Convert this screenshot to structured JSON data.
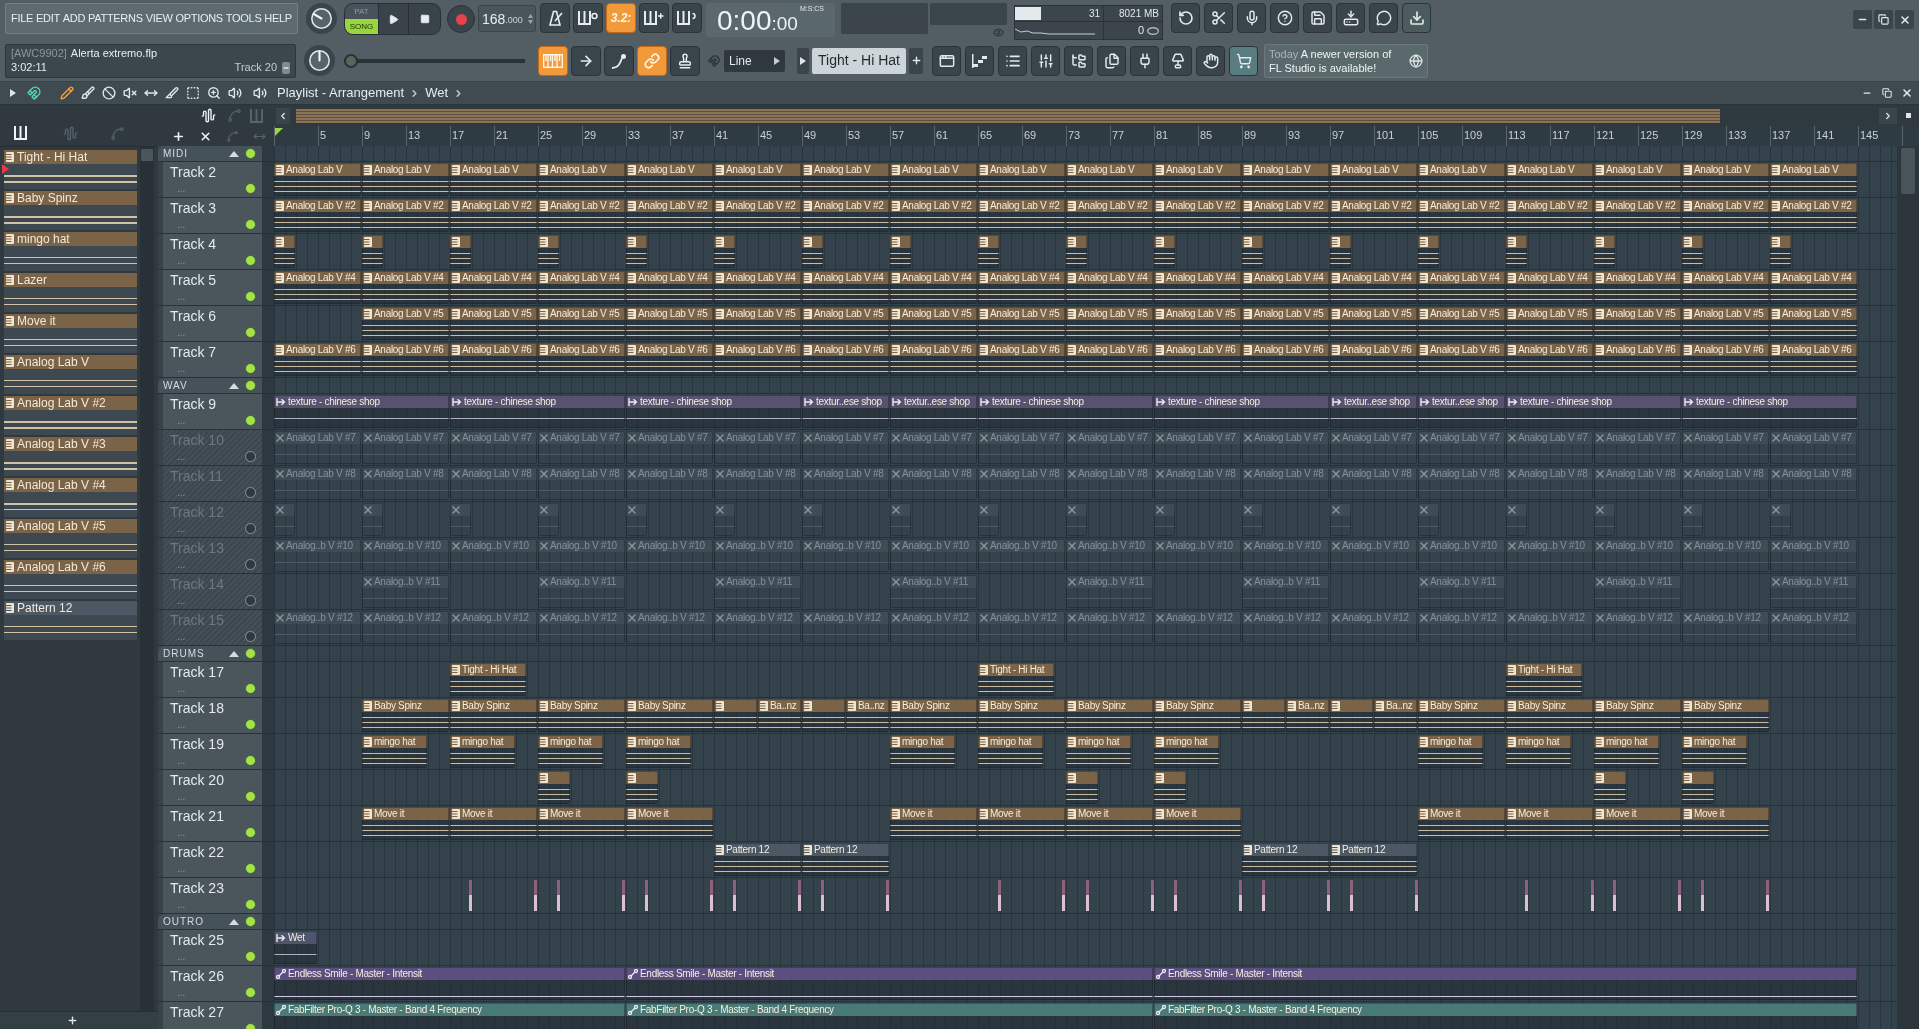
{
  "menu": [
    "FILE",
    "EDIT",
    "ADD",
    "PATTERNS",
    "VIEW",
    "OPTIONS",
    "TOOLS",
    "HELP"
  ],
  "mode": [
    {
      "label": "PAT",
      "selected": false
    },
    {
      "label": "SONG",
      "selected": true
    }
  ],
  "tempo": {
    "whole": "168",
    "fraction": ".000"
  },
  "record_toggles": [
    {
      "kind": "metronome",
      "on": false
    },
    {
      "kind": "wait",
      "on": false
    },
    {
      "kind": "countdown",
      "label": "3.2:",
      "on": true
    },
    {
      "kind": "overdub",
      "on": false
    },
    {
      "kind": "loop",
      "on": false
    }
  ],
  "time": {
    "main": "0:00",
    "fraction": ":00",
    "format": "M:S:CS"
  },
  "monitor": {
    "cpu": "31",
    "cpu_meter": {
      "level": 0.3
    },
    "memory": "8021 MB",
    "polyphony": "0"
  },
  "project": {
    "tag": "[AWC9902]",
    "file": "Alerta extremo.flp",
    "length": "3:02:11",
    "hint": "Track 20"
  },
  "song_position": {
    "level": 0
  },
  "edit_toggles": [
    {
      "kind": "keyboard",
      "on": true
    },
    {
      "kind": "arrow",
      "on": false
    },
    {
      "kind": "slide",
      "on": false
    },
    {
      "kind": "link",
      "on": true
    },
    {
      "kind": "stamp",
      "on": false
    }
  ],
  "snap": "Line",
  "pattern_selector": "Tight - Hi Hat",
  "news": {
    "date": "Today",
    "text": "A newer version of FL Studio is available!"
  },
  "playlist": {
    "title": "Playlist - Arrangement",
    "breadcrumb": "Wet",
    "tools": [
      {
        "kind": "pencil",
        "selected": true
      },
      {
        "kind": "paint",
        "selected": false
      },
      {
        "kind": "delete",
        "selected": false
      },
      {
        "kind": "mute",
        "selected": false
      },
      {
        "kind": "slip",
        "selected": false
      },
      {
        "kind": "slice",
        "selected": false
      },
      {
        "kind": "select",
        "selected": false
      },
      {
        "kind": "zoom",
        "selected": false
      },
      {
        "kind": "playback",
        "selected": false
      }
    ],
    "browser_tabs": [
      {
        "kind": "piano",
        "selected": true
      },
      {
        "kind": "wave",
        "selected": false
      },
      {
        "kind": "automation",
        "selected": false
      }
    ],
    "patterns": [
      {
        "name": "Tight - Hi Hat",
        "color": "#7b6347",
        "selected": true
      },
      {
        "name": "Baby Spinz",
        "color": "#7b6347",
        "selected": false
      },
      {
        "name": "mingo hat",
        "color": "#7b6347",
        "selected": false
      },
      {
        "name": "Lazer",
        "color": "#7b6347",
        "selected": false
      },
      {
        "name": "Move it",
        "color": "#7b6347",
        "selected": false
      },
      {
        "name": "Analog Lab V",
        "color": "#7b6347",
        "selected": false
      },
      {
        "name": "Analog Lab V #2",
        "color": "#7b6347",
        "selected": false
      },
      {
        "name": "Analog Lab V #3",
        "color": "#7b6347",
        "selected": false
      },
      {
        "name": "Analog Lab V #4",
        "color": "#7b6347",
        "selected": false
      },
      {
        "name": "Analog Lab V #5",
        "color": "#7b6347",
        "selected": false
      },
      {
        "name": "Analog Lab V #6",
        "color": "#7b6347",
        "selected": false
      },
      {
        "name": "Pattern 12",
        "color": "#4c5863",
        "selected": false
      }
    ],
    "track_filters": [
      {
        "kind": "wave",
        "on": true
      },
      {
        "kind": "automation",
        "on": false
      },
      {
        "kind": "piano",
        "on": false
      }
    ],
    "track_tools": [
      {
        "kind": "add",
        "disabled": false
      },
      {
        "kind": "remove",
        "disabled": false
      },
      {
        "kind": "curve",
        "disabled": true
      },
      {
        "kind": "swap",
        "disabled": true
      }
    ],
    "ruler": [
      "5",
      "9",
      "13",
      "17",
      "21",
      "25",
      "29",
      "33",
      "37",
      "41",
      "45",
      "49",
      "53",
      "57",
      "61",
      "65",
      "69",
      "73",
      "77",
      "81",
      "85",
      "89",
      "93",
      "97",
      "101",
      "105",
      "109",
      "113",
      "117",
      "121",
      "125",
      "129",
      "133",
      "137",
      "141",
      "145"
    ],
    "groups": [
      {
        "name": "MIDI",
        "enabled": true,
        "expanded": true,
        "tracks": [
          {
            "name": "Track 2",
            "subtitle": "...",
            "enabled": true,
            "color": "#7b6347",
            "kind": "pattern",
            "clips": [
              {
                "label": "Analog Lab V",
                "selected": false
              },
              {
                "label": "Analog Lab V",
                "selected": false
              },
              {
                "label": "Analog Lab V",
                "selected": false
              },
              {
                "label": "Analog Lab V",
                "selected": false
              },
              {
                "label": "Analog Lab V",
                "selected": false
              },
              {
                "label": "Analog Lab V",
                "selected": false
              },
              {
                "label": "Analog Lab V",
                "selected": false
              },
              {
                "label": "Analog Lab V",
                "selected": false
              },
              {
                "label": "Analog Lab V",
                "selected": false
              },
              {
                "label": "Analog Lab V",
                "selected": false
              },
              {
                "label": "Analog Lab V",
                "selected": false
              },
              {
                "label": "Analog Lab V",
                "selected": false
              },
              {
                "label": "Analog Lab V",
                "selected": false
              },
              {
                "label": "Analog Lab V",
                "selected": false
              },
              {
                "label": "Analog Lab V",
                "selected": false
              },
              {
                "label": "Analog Lab V",
                "selected": false
              },
              {
                "label": "Analog Lab V",
                "selected": false
              },
              {
                "label": "Analog Lab V",
                "selected": false
              }
            ]
          },
          {
            "name": "Track 3",
            "subtitle": "...",
            "enabled": true,
            "color": "#7b6347",
            "kind": "pattern",
            "clips": [
              {
                "label": "Analog Lab V #2",
                "selected": false
              },
              {
                "label": "Analog Lab V #2",
                "selected": false
              },
              {
                "label": "Analog Lab V #2",
                "selected": false
              },
              {
                "label": "Analog Lab V #2",
                "selected": false
              },
              {
                "label": "Analog Lab V #2",
                "selected": false
              },
              {
                "label": "Analog Lab V #2",
                "selected": false
              },
              {
                "label": "Analog Lab V #2",
                "selected": false
              },
              {
                "label": "Analog Lab V #2",
                "selected": false
              },
              {
                "label": "Analog Lab V #2",
                "selected": false
              },
              {
                "label": "Analog Lab V #2",
                "selected": false
              },
              {
                "label": "Analog Lab V #2",
                "selected": false
              },
              {
                "label": "Analog Lab V #2",
                "selected": false
              },
              {
                "label": "Analog Lab V #2",
                "selected": false
              },
              {
                "label": "Analog Lab V #2",
                "selected": false
              },
              {
                "label": "Analog Lab V #2",
                "selected": false
              },
              {
                "label": "Analog Lab V #2",
                "selected": false
              },
              {
                "label": "Analog Lab V #2",
                "selected": false
              },
              {
                "label": "Analog Lab V #2",
                "selected": false
              }
            ]
          },
          {
            "name": "Track 4",
            "subtitle": "...",
            "enabled": true,
            "color": "#7b6347",
            "kind": "pattern",
            "clips": [
              {
                "selected": false
              },
              {
                "selected": false
              },
              {
                "selected": false
              },
              {
                "selected": false
              },
              {
                "selected": false
              },
              {
                "selected": false
              },
              {
                "selected": false
              },
              {
                "selected": false
              },
              {
                "selected": false
              },
              {
                "selected": false
              },
              {
                "selected": false
              },
              {
                "selected": false
              },
              {
                "selected": false
              },
              {
                "selected": false
              },
              {
                "selected": false
              },
              {
                "selected": false
              },
              {
                "selected": false
              },
              {
                "selected": false
              }
            ]
          },
          {
            "name": "Track 5",
            "subtitle": "...",
            "enabled": true,
            "color": "#7b6347",
            "kind": "pattern",
            "clips": [
              {
                "label": "Analog Lab V #4",
                "selected": false
              },
              {
                "label": "Analog Lab V #4",
                "selected": false
              },
              {
                "label": "Analog Lab V #4",
                "selected": false
              },
              {
                "label": "Analog Lab V #4",
                "selected": false
              },
              {
                "label": "Analog Lab V #4",
                "selected": false
              },
              {
                "label": "Analog Lab V #4",
                "selected": false
              },
              {
                "label": "Analog Lab V #4",
                "selected": false
              },
              {
                "label": "Analog Lab V #4",
                "selected": false
              },
              {
                "label": "Analog Lab V #4",
                "selected": false
              },
              {
                "label": "Analog Lab V #4",
                "selected": false
              },
              {
                "label": "Analog Lab V #4",
                "selected": false
              },
              {
                "label": "Analog Lab V #4",
                "selected": false
              },
              {
                "label": "Analog Lab V #4",
                "selected": false
              },
              {
                "label": "Analog Lab V #4",
                "selected": false
              },
              {
                "label": "Analog Lab V #4",
                "selected": false
              },
              {
                "label": "Analog Lab V #4",
                "selected": false
              },
              {
                "label": "Analog Lab V #4",
                "selected": false
              },
              {
                "label": "Analog Lab V #4",
                "selected": false
              }
            ]
          },
          {
            "name": "Track 6",
            "subtitle": "...",
            "enabled": true,
            "color": "#7b6347",
            "kind": "pattern",
            "clips": [
              {
                "label": "Analog Lab V #5",
                "selected": false
              },
              {
                "label": "Analog Lab V #5",
                "selected": false
              },
              {
                "label": "Analog Lab V #5",
                "selected": false
              },
              {
                "label": "Analog Lab V #5",
                "selected": false
              },
              {
                "label": "Analog Lab V #5",
                "selected": false
              },
              {
                "label": "Analog Lab V #5",
                "selected": false
              },
              {
                "label": "Analog Lab V #5",
                "selected": false
              },
              {
                "label": "Analog Lab V #5",
                "selected": false
              },
              {
                "label": "Analog Lab V #5",
                "selected": false
              },
              {
                "label": "Analog Lab V #5",
                "selected": false
              },
              {
                "label": "Analog Lab V #5",
                "selected": false
              },
              {
                "label": "Analog Lab V #5",
                "selected": false
              },
              {
                "label": "Analog Lab V #5",
                "selected": false
              },
              {
                "label": "Analog Lab V #5",
                "selected": false
              },
              {
                "label": "Analog Lab V #5",
                "selected": false
              },
              {
                "label": "Analog Lab V #5",
                "selected": false
              },
              {
                "label": "Analog Lab V #5",
                "selected": false
              }
            ]
          },
          {
            "name": "Track 7",
            "subtitle": "...",
            "enabled": true,
            "color": "#7b6347",
            "kind": "pattern",
            "clips": [
              {
                "label": "Analog Lab V #6",
                "selected": false
              },
              {
                "label": "Analog Lab V #6",
                "selected": false
              },
              {
                "label": "Analog Lab V #6",
                "selected": false
              },
              {
                "label": "Analog Lab V #6",
                "selected": false
              },
              {
                "label": "Analog Lab V #6",
                "selected": false
              },
              {
                "label": "Analog Lab V #6",
                "selected": false
              },
              {
                "label": "Analog Lab V #6",
                "selected": false
              },
              {
                "label": "Analog Lab V #6",
                "selected": false
              },
              {
                "label": "Analog Lab V #6",
                "selected": false
              },
              {
                "label": "Analog Lab V #6",
                "selected": false
              },
              {
                "label": "Analog Lab V #6",
                "selected": false
              },
              {
                "label": "Analog Lab V #6",
                "selected": false
              },
              {
                "label": "Analog Lab V #6",
                "selected": false
              },
              {
                "label": "Analog Lab V #6",
                "selected": false
              },
              {
                "label": "Analog Lab V #6",
                "selected": false
              },
              {
                "label": "Analog Lab V #6",
                "selected": false
              },
              {
                "label": "Analog Lab V #6",
                "selected": false
              },
              {
                "label": "Analog Lab V #6",
                "selected": false
              }
            ]
          }
        ]
      },
      {
        "name": "WAV",
        "enabled": true,
        "expanded": true,
        "tracks": [
          {
            "name": "Track 9",
            "subtitle": "...",
            "enabled": true,
            "color": "#57526f",
            "kind": "audio",
            "clips": [
              {
                "label": "texture - chinese shop",
                "selected": false
              },
              {
                "label": "texture - chinese shop",
                "selected": false
              },
              {
                "label": "texture - chinese shop",
                "selected": false
              },
              {
                "label": "textur..ese shop",
                "selected": false
              },
              {
                "label": "textur..ese shop",
                "selected": false
              },
              {
                "label": "texture - chinese shop",
                "selected": false
              },
              {
                "label": "texture - chinese shop",
                "selected": false
              },
              {
                "label": "textur..ese shop",
                "selected": false
              },
              {
                "label": "textur..ese shop",
                "selected": false
              },
              {
                "label": "texture - chinese shop",
                "selected": false
              },
              {
                "label": "texture - chinese shop",
                "selected": false
              }
            ]
          },
          {
            "name": "Track 10",
            "subtitle": "...",
            "enabled": false,
            "color": "#3f4c56",
            "kind": "pattern",
            "clips": [
              {
                "label": "Analog Lab V #7",
                "selected": false
              },
              {
                "label": "Analog Lab V #7",
                "selected": false
              },
              {
                "label": "Analog Lab V #7",
                "selected": false
              },
              {
                "label": "Analog Lab V #7",
                "selected": false
              },
              {
                "label": "Analog Lab V #7",
                "selected": false
              },
              {
                "label": "Analog Lab V #7",
                "selected": false
              },
              {
                "label": "Analog Lab V #7",
                "selected": false
              },
              {
                "label": "Analog Lab V #7",
                "selected": false
              },
              {
                "label": "Analog Lab V #7",
                "selected": false
              },
              {
                "label": "Analog Lab V #7",
                "selected": false
              },
              {
                "label": "Analog Lab V #7",
                "selected": false
              },
              {
                "label": "Analog Lab V #7",
                "selected": false
              },
              {
                "label": "Analog Lab V #7",
                "selected": false
              },
              {
                "label": "Analog Lab V #7",
                "selected": false
              },
              {
                "label": "Analog Lab V #7",
                "selected": false
              },
              {
                "label": "Analog Lab V #7",
                "selected": false
              },
              {
                "label": "Analog Lab V #7",
                "selected": false
              },
              {
                "label": "Analog Lab V #7",
                "selected": false
              }
            ]
          },
          {
            "name": "Track 11",
            "subtitle": "...",
            "enabled": false,
            "color": "#3f4c56",
            "kind": "pattern",
            "clips": [
              {
                "label": "Analog Lab V #8",
                "selected": false
              },
              {
                "label": "Analog Lab V #8",
                "selected": false
              },
              {
                "label": "Analog Lab V #8",
                "selected": false
              },
              {
                "label": "Analog Lab V #8",
                "selected": false
              },
              {
                "label": "Analog Lab V #8",
                "selected": false
              },
              {
                "label": "Analog Lab V #8",
                "selected": false
              },
              {
                "label": "Analog Lab V #8",
                "selected": false
              },
              {
                "label": "Analog Lab V #8",
                "selected": false
              },
              {
                "label": "Analog Lab V #8",
                "selected": false
              },
              {
                "label": "Analog Lab V #8",
                "selected": false
              },
              {
                "label": "Analog Lab V #8",
                "selected": false
              },
              {
                "label": "Analog Lab V #8",
                "selected": false
              },
              {
                "label": "Analog Lab V #8",
                "selected": false
              },
              {
                "label": "Analog Lab V #8",
                "selected": false
              },
              {
                "label": "Analog Lab V #8",
                "selected": false
              },
              {
                "label": "Analog Lab V #8",
                "selected": false
              },
              {
                "label": "Analog Lab V #8",
                "selected": false
              },
              {
                "label": "Analog Lab V #8",
                "selected": false
              }
            ]
          },
          {
            "name": "Track 12",
            "subtitle": "...",
            "enabled": false,
            "color": "#3f4c56",
            "kind": "pattern",
            "clips": [
              {
                "selected": false
              },
              {
                "selected": false
              },
              {
                "selected": false
              },
              {
                "selected": false
              },
              {
                "selected": false
              },
              {
                "selected": false
              },
              {
                "selected": false
              },
              {
                "selected": false
              },
              {
                "selected": false
              },
              {
                "selected": false
              },
              {
                "selected": false
              },
              {
                "selected": false
              },
              {
                "selected": false
              },
              {
                "selected": false
              },
              {
                "selected": false
              },
              {
                "selected": false
              },
              {
                "selected": false
              },
              {
                "selected": false
              }
            ]
          },
          {
            "name": "Track 13",
            "subtitle": "...",
            "enabled": false,
            "color": "#3f4c56",
            "kind": "pattern",
            "clips": [
              {
                "label": "Analog..b V #10",
                "selected": false
              },
              {
                "label": "Analog..b V #10",
                "selected": false
              },
              {
                "label": "Analog..b V #10",
                "selected": false
              },
              {
                "label": "Analog..b V #10",
                "selected": false
              },
              {
                "label": "Analog..b V #10",
                "selected": false
              },
              {
                "label": "Analog..b V #10",
                "selected": false
              },
              {
                "label": "Analog..b V #10",
                "selected": false
              },
              {
                "label": "Analog..b V #10",
                "selected": false
              },
              {
                "label": "Analog..b V #10",
                "selected": false
              },
              {
                "label": "Analog..b V #10",
                "selected": false
              },
              {
                "label": "Analog..b V #10",
                "selected": false
              },
              {
                "label": "Analog..b V #10",
                "selected": false
              },
              {
                "label": "Analog..b V #10",
                "selected": false
              },
              {
                "label": "Analog..b V #10",
                "selected": false
              },
              {
                "label": "Analog..b V #10",
                "selected": false
              },
              {
                "label": "Analog..b V #10",
                "selected": false
              },
              {
                "label": "Analog..b V #10",
                "selected": false
              },
              {
                "label": "Analog..b V #10",
                "selected": false
              }
            ]
          },
          {
            "name": "Track 14",
            "subtitle": "...",
            "enabled": false,
            "color": "#3f4c56",
            "kind": "pattern",
            "clips": [
              {
                "label": "Analog..b V #11",
                "selected": false
              },
              {
                "label": "Analog..b V #11",
                "selected": false
              },
              {
                "label": "Analog..b V #11",
                "selected": false
              },
              {
                "label": "Analog..b V #11",
                "selected": false
              },
              {
                "label": "Analog..b V #11",
                "selected": false
              },
              {
                "label": "Analog..b V #11",
                "selected": false
              },
              {
                "label": "Analog..b V #11",
                "selected": false
              },
              {
                "label": "Analog..b V #11",
                "selected": false
              },
              {
                "label": "Analog..b V #11",
                "selected": false
              }
            ]
          },
          {
            "name": "Track 15",
            "subtitle": "...",
            "enabled": false,
            "color": "#3f4c56",
            "kind": "pattern",
            "clips": [
              {
                "label": "Analog..b V #12",
                "selected": false
              },
              {
                "label": "Analog..b V #12",
                "selected": false
              },
              {
                "label": "Analog..b V #12",
                "selected": false
              },
              {
                "label": "Analog..b V #12",
                "selected": false
              },
              {
                "label": "Analog..b V #12",
                "selected": false
              },
              {
                "label": "Analog..b V #12",
                "selected": false
              },
              {
                "label": "Analog..b V #12",
                "selected": false
              },
              {
                "label": "Analog..b V #12",
                "selected": false
              },
              {
                "label": "Analog..b V #12",
                "selected": false
              },
              {
                "label": "Analog..b V #12",
                "selected": false
              },
              {
                "label": "Analog..b V #12",
                "selected": false
              },
              {
                "label": "Analog..b V #12",
                "selected": false
              },
              {
                "label": "Analog..b V #12",
                "selected": false
              },
              {
                "label": "Analog..b V #12",
                "selected": false
              },
              {
                "label": "Analog..b V #12",
                "selected": false
              },
              {
                "label": "Analog..b V #12",
                "selected": false
              },
              {
                "label": "Analog..b V #12",
                "selected": false
              },
              {
                "label": "Analog..b V #12",
                "selected": false
              }
            ]
          }
        ]
      },
      {
        "name": "DRUMS",
        "enabled": true,
        "expanded": true,
        "tracks": [
          {
            "name": "Track 17",
            "subtitle": "...",
            "enabled": true,
            "color": "#7b6347",
            "kind": "pattern",
            "clips": [
              {
                "label": "Tight - Hi Hat",
                "selected": false
              },
              {
                "label": "Tight - Hi Hat",
                "selected": false
              },
              {
                "label": "Tight - Hi Hat",
                "selected": false
              }
            ]
          },
          {
            "name": "Track 18",
            "subtitle": "...",
            "enabled": true,
            "color": "#7b6347",
            "kind": "pattern",
            "clips": [
              {
                "label": "Baby Spinz",
                "selected": false
              },
              {
                "label": "Baby Spinz",
                "selected": false
              },
              {
                "label": "Baby Spinz",
                "selected": false
              },
              {
                "label": "Baby Spinz",
                "selected": false
              },
              {
                "selected": false
              },
              {
                "label": "Ba..nz",
                "selected": false
              },
              {
                "selected": false
              },
              {
                "label": "Ba..nz",
                "selected": false
              },
              {
                "label": "Baby Spinz",
                "selected": false
              },
              {
                "label": "Baby Spinz",
                "selected": false
              },
              {
                "label": "Baby Spinz",
                "selected": false
              },
              {
                "label": "Baby Spinz",
                "selected": false
              },
              {
                "selected": false
              },
              {
                "label": "Ba..nz",
                "selected": false
              },
              {
                "selected": false
              },
              {
                "label": "Ba..nz",
                "selected": false
              },
              {
                "label": "Baby Spinz",
                "selected": false
              },
              {
                "label": "Baby Spinz",
                "selected": false
              },
              {
                "label": "Baby Spinz",
                "selected": false
              },
              {
                "label": "Baby Spinz",
                "selected": false
              }
            ]
          },
          {
            "name": "Track 19",
            "subtitle": "...",
            "enabled": true,
            "color": "#7b6347",
            "kind": "pattern",
            "clips": [
              {
                "label": "mingo hat",
                "selected": false
              },
              {
                "label": "mingo hat",
                "selected": false
              },
              {
                "label": "mingo hat",
                "selected": false
              },
              {
                "label": "mingo hat",
                "selected": false
              },
              {
                "label": "mingo hat",
                "selected": false
              },
              {
                "label": "mingo hat",
                "selected": false
              },
              {
                "label": "mingo hat",
                "selected": false
              },
              {
                "label": "mingo hat",
                "selected": false
              },
              {
                "label": "mingo hat",
                "selected": false
              },
              {
                "label": "mingo hat",
                "selected": false
              },
              {
                "label": "mingo hat",
                "selected": false
              },
              {
                "label": "mingo hat",
                "selected": false
              }
            ]
          },
          {
            "name": "Track 20",
            "subtitle": "...",
            "enabled": true,
            "color": "#7b6347",
            "kind": "pattern",
            "clips": [
              {
                "selected": false
              },
              {
                "selected": false
              },
              {
                "selected": false
              },
              {
                "selected": false
              },
              {
                "selected": false
              },
              {
                "selected": false
              }
            ]
          },
          {
            "name": "Track 21",
            "subtitle": "...",
            "enabled": true,
            "color": "#7b6347",
            "kind": "pattern",
            "clips": [
              {
                "label": "Move it",
                "selected": false
              },
              {
                "label": "Move it",
                "selected": false
              },
              {
                "label": "Move it",
                "selected": false
              },
              {
                "label": "Move it",
                "selected": false
              },
              {
                "label": "Move it",
                "selected": false
              },
              {
                "label": "Move it",
                "selected": false
              },
              {
                "label": "Move it",
                "selected": false
              },
              {
                "label": "Move it",
                "selected": false
              },
              {
                "label": "Move it",
                "selected": false
              },
              {
                "label": "Move it",
                "selected": false
              },
              {
                "label": "Move it",
                "selected": false
              },
              {
                "label": "Move it",
                "selected": false
              }
            ]
          },
          {
            "name": "Track 22",
            "subtitle": "...",
            "enabled": true,
            "color": "#4c5863",
            "kind": "pattern",
            "clips": [
              {
                "label": "Pattern 12",
                "selected": false
              },
              {
                "label": "Pattern 12",
                "selected": false
              },
              {
                "label": "Pattern 12",
                "selected": false
              },
              {
                "label": "Pattern 12",
                "selected": false
              }
            ]
          },
          {
            "name": "Track 23",
            "subtitle": "...",
            "enabled": true,
            "kind": "marks"
          }
        ]
      },
      {
        "name": "OUTRO",
        "enabled": true,
        "expanded": true,
        "tracks": [
          {
            "name": "Track 25",
            "subtitle": "...",
            "enabled": true,
            "color": "#4f566b",
            "kind": "audio",
            "clips": [
              {
                "label": "Wet",
                "selected": false
              }
            ]
          },
          {
            "name": "Track 26",
            "subtitle": "...",
            "enabled": true,
            "color": "#5c4f80",
            "kind": "automation",
            "clips": [
              {
                "label": "Endless Smile - Master - Intensit",
                "selected": false
              },
              {
                "label": "Endless Smile - Master - Intensit",
                "selected": false
              },
              {
                "label": "Endless Smile - Master - Intensit",
                "selected": false
              }
            ]
          },
          {
            "name": "Track 27",
            "enabled": true,
            "color": "#4a7a75",
            "kind": "automation",
            "clips": [
              {
                "label": "FabFilter Pro-Q 3 - Master - Band 4 Frequency",
                "selected": false
              },
              {
                "label": "FabFilter Pro-Q 3 - Master - Band 4 Frequency",
                "selected": false
              },
              {
                "label": "FabFilter Pro-Q 3 - Master - Band 4 Frequency",
                "selected": false
              }
            ]
          }
        ]
      }
    ]
  }
}
